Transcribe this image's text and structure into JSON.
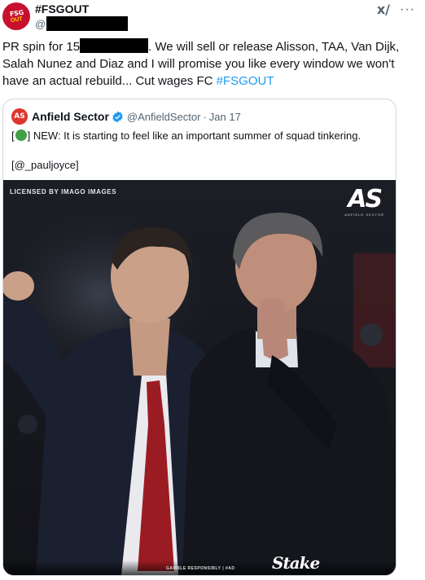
{
  "tweet": {
    "author_name": "#FSGOUT",
    "handle_prefix": "@",
    "avatar_text_top": "FSG",
    "avatar_text_bottom": "OUT",
    "text_before_redaction": "PR spin for 15",
    "text_after_redaction": ". We will sell  or release Alisson, TAA, Van Dijk, Salah Nunez and Diaz and I will promise you like every window  we won't have an actual rebuild... Cut wages FC ",
    "hashtag": "#FSGOUT",
    "grok_icon": "grok-icon",
    "more_icon": "more-icon"
  },
  "quote": {
    "avatar_text": "AS",
    "name": "Anfield Sector",
    "verified": true,
    "handle": "@AnfieldSector",
    "dot": "·",
    "date": "Jan 17",
    "text_open_bracket": "[",
    "text_main": "] NEW: It is starting to feel like an important summer of squad tinkering.",
    "source": "[@_pauljoyce]",
    "photo": {
      "watermark": "LICENSED BY IMAGO IMAGES",
      "logo_mark": "AS",
      "logo_sub": "ANFIELD SECTOR",
      "gamble_text": "GAMBLE RESPONSIBLY | #AD",
      "sponsor": "Stake"
    }
  },
  "colors": {
    "accent": "#1d9bf0",
    "text": "#0f1419",
    "muted": "#536471",
    "border": "#cfd9de",
    "brand_red": "#c8102e"
  }
}
